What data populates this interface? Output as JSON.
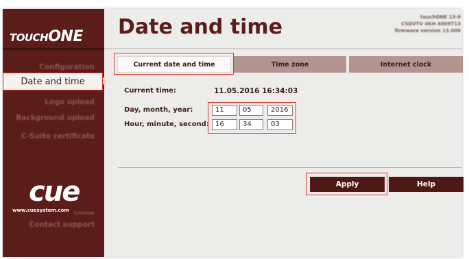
{
  "brand": {
    "logo_small": "TOUCH",
    "logo_big": "ONE",
    "cue_logo": "cue",
    "cue_url": "www.cuesystem.com"
  },
  "header": {
    "title": "Date and time",
    "info_lines": [
      "touchONE 13-8",
      "CSDVTV 4KH 4009713",
      "firmware version 13.006"
    ]
  },
  "sidebar": {
    "items": [
      {
        "label": "Configuration"
      },
      {
        "label": "Date and time"
      },
      {
        "label": "Logo upload"
      },
      {
        "label": "Background upload"
      },
      {
        "label": "C-Suite certificate"
      },
      {
        "label": "License"
      },
      {
        "label": "Contact support"
      }
    ]
  },
  "tabs": [
    {
      "label": "Current date and time"
    },
    {
      "label": "Time zone"
    },
    {
      "label": "Internet clock"
    }
  ],
  "form": {
    "current_time_label": "Current time:",
    "current_time_value": "11.05.2016  16:34:03",
    "dmy_label": "Day, month, year:",
    "hms_label": "Hour, minute, second:",
    "day": "11",
    "month": "05",
    "year": "2016",
    "hour": "16",
    "minute": "34",
    "second": "03"
  },
  "buttons": {
    "apply": "Apply",
    "help": "Help"
  },
  "colors": {
    "brand_dark": "#5a1d1a",
    "tab_inactive": "#b3948f",
    "highlight_red": "#e0332a"
  }
}
